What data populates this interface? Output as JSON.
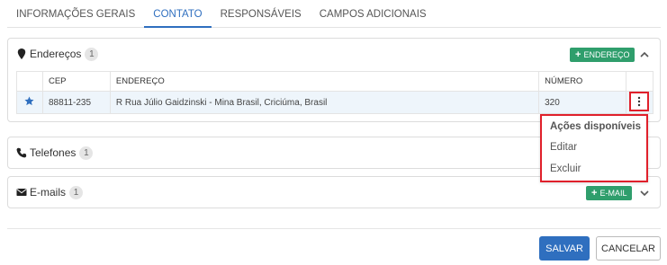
{
  "tabs": [
    {
      "label": "INFORMAÇÕES GERAIS",
      "active": false
    },
    {
      "label": "CONTATO",
      "active": true
    },
    {
      "label": "RESPONSÁVEIS",
      "active": false
    },
    {
      "label": "CAMPOS ADICIONAIS",
      "active": false
    }
  ],
  "addresses": {
    "title": "Endereços",
    "count": "1",
    "add_label": "ENDEREÇO",
    "columns": [
      "CEP",
      "ENDEREÇO",
      "NÚMERO"
    ],
    "rows": [
      {
        "cep": "88811-235",
        "endereco": "R Rua Júlio Gaidzinski - Mina Brasil, Criciúma, Brasil",
        "numero": "320",
        "favorite": true
      }
    ]
  },
  "actions_menu": {
    "header": "Ações disponíveis",
    "items": [
      "Editar",
      "Excluir"
    ]
  },
  "phones": {
    "title": "Telefones",
    "count": "1"
  },
  "emails": {
    "title": "E-mails",
    "count": "1",
    "add_label": "E-MAIL"
  },
  "footer": {
    "save_label": "SALVAR",
    "cancel_label": "CANCELAR"
  },
  "colors": {
    "primary": "#2f6fbf",
    "success": "#2f9e6c",
    "highlight": "#e0202b",
    "row_bg": "#eef5fb"
  },
  "icons": {
    "address": "map-pin-icon",
    "phone": "phone-icon",
    "email": "envelope-icon",
    "favorite": "star-icon",
    "menu": "kebab-menu-icon",
    "collapse": "chevron-up-icon",
    "expand": "chevron-down-icon"
  }
}
